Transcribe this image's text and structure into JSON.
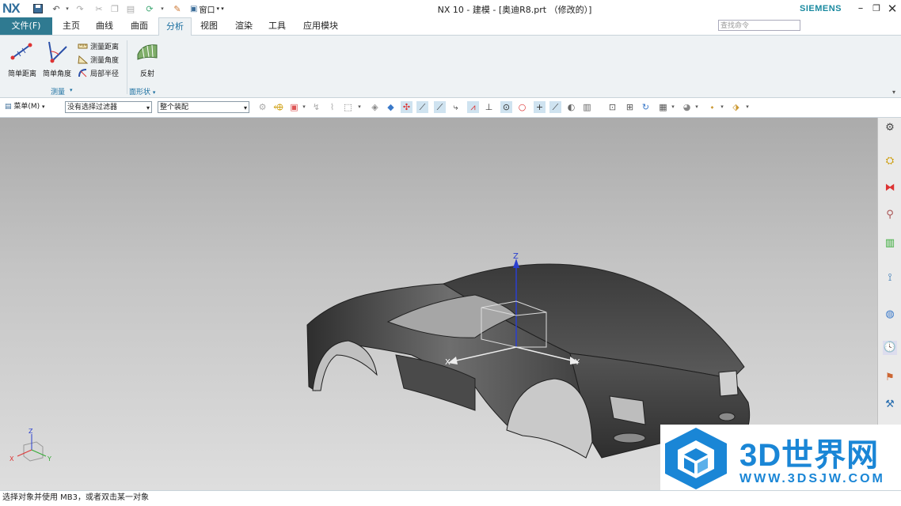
{
  "app": {
    "logo": "NX",
    "title": "NX 10 - 建模 - [奥迪R8.prt （修改的）]",
    "brand": "SIEMENS",
    "window_menu": "窗口",
    "accent": "#2f7a91"
  },
  "menubar": {
    "file": "文件(F)",
    "tabs": [
      "主页",
      "曲线",
      "曲面",
      "分析",
      "视图",
      "渲染",
      "工具",
      "应用模块"
    ],
    "active_tab": "分析",
    "search_placeholder": "查找命令"
  },
  "ribbon": {
    "measure": {
      "simple_distance": "简单距离",
      "simple_angle": "简单角度",
      "measure_distance": "测量距离",
      "measure_angle": "测量角度",
      "local_radius": "局部半径",
      "group_label": "测量"
    },
    "shape": {
      "reflection": "反射",
      "group_label": "面形状"
    }
  },
  "toolbar": {
    "menu_label": "菜单(M)",
    "filter_value": "没有选择过滤器",
    "assembly_value": "整个装配"
  },
  "viewport": {
    "axis_z": "Z",
    "axis_x": "X",
    "axis_y": "Y",
    "triad_z": "Z",
    "triad_x": "X",
    "triad_y": "Y"
  },
  "status": {
    "message": "选择对象并使用 MB3，或者双击某一对象"
  },
  "watermark": {
    "text": "3D世界网",
    "url": "WWW.3DSJW.COM"
  }
}
